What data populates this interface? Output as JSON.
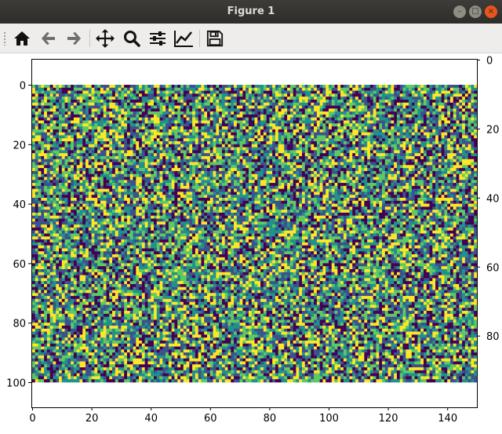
{
  "window": {
    "title": "Figure 1",
    "min_glyph": "–",
    "max_glyph": "□",
    "close_glyph": "×"
  },
  "toolbar": {
    "items": [
      {
        "name": "home-button",
        "icon": "home-icon"
      },
      {
        "name": "back-button",
        "icon": "arrow-left-icon"
      },
      {
        "name": "forward-button",
        "icon": "arrow-right-icon"
      },
      {
        "name": "pan-button",
        "icon": "move-icon"
      },
      {
        "name": "zoom-button",
        "icon": "magnifier-icon"
      },
      {
        "name": "subplots-button",
        "icon": "sliders-icon"
      },
      {
        "name": "axes-edit-button",
        "icon": "line-chart-icon"
      },
      {
        "name": "save-button",
        "icon": "floppy-disk-icon"
      }
    ]
  },
  "chart_data": {
    "type": "heatmap",
    "description_of_content": "",
    "colormap": "viridis",
    "colors": [
      "#440154",
      "#3b528b",
      "#21918c",
      "#5ec962",
      "#fde725"
    ],
    "rows": 100,
    "cols": 150,
    "xlim": [
      0,
      150
    ],
    "ylim": [
      100,
      0
    ],
    "x_ticks": [
      "0",
      "20",
      "40",
      "60",
      "80",
      "100",
      "120",
      "140"
    ],
    "y_ticks_left": [
      "0",
      "20",
      "40",
      "60",
      "80",
      "100"
    ],
    "y_ticks_right": [
      "0",
      "20",
      "40",
      "60",
      "80"
    ],
    "grid": false
  }
}
